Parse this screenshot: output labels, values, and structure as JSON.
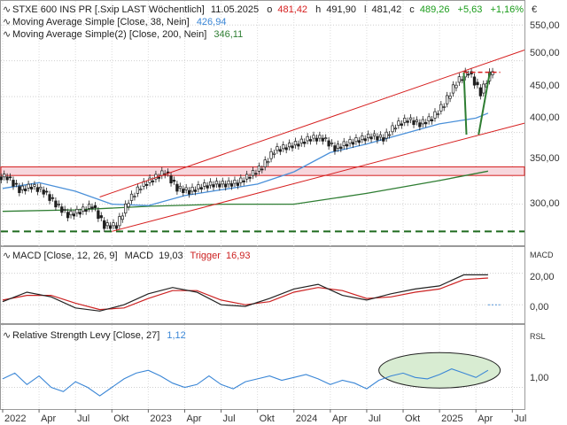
{
  "header": {
    "main": {
      "title": "STXE 600 INS PR [.Sxip LAST Wöchentlich]",
      "date": "11.05.2025",
      "o_label": "o",
      "o": "481,42",
      "h_label": "h",
      "h": "491,90",
      "l_label": "l",
      "l": "481,42",
      "c_label": "c",
      "c": "489,26",
      "change": "+5,63",
      "change_pct": "+1,16%"
    },
    "ma1": {
      "label": "Moving Average Simple [Close, 38, Nein]",
      "value": "426,94"
    },
    "ma2": {
      "label": "Moving Average Simple(2) [Close, 200, Nein]",
      "value": "346,11"
    },
    "macd": {
      "label": "MACD [Close, 12, 26, 9]",
      "macd_label": "MACD",
      "macd": "19,03",
      "trigger_label": "Trigger",
      "trigger": "16,93"
    },
    "rsl": {
      "label": "Relative Strength Levy [Close, 27]",
      "value": "1,12"
    }
  },
  "axis": {
    "currency": "€",
    "price_ticks": [
      "550,00",
      "500,00",
      "450,00",
      "400,00",
      "350,00",
      "300,00"
    ],
    "macd_name": "MACD",
    "macd_ticks": [
      "20,00",
      "0,00"
    ],
    "rsl_name": "RSL",
    "rsl_ticks": [
      "1,00"
    ],
    "x_ticks": [
      "2022",
      "Apr",
      "Jul",
      "Okt",
      "2023",
      "Apr",
      "Jul",
      "Okt",
      "2024",
      "Apr",
      "Jul",
      "Okt",
      "2025",
      "Apr",
      "Jul"
    ]
  },
  "colors": {
    "price": "#1f1f1f",
    "ma38": "#4a90d9",
    "ma200": "#2e7d32",
    "trend_channel": "#d62020",
    "resistance_band": "#d62020",
    "support_dashed": "#1e6b1e",
    "macd": "#222222",
    "trigger": "#cc2222",
    "rsl": "#3a86d6",
    "highlight_ellipse": "#c8e6c0",
    "up": "#1a9c1a",
    "down": "#d62020"
  },
  "chart_data": [
    {
      "type": "candlestick",
      "x_range": [
        "2022-01",
        "2025-08"
      ],
      "ylim": [
        255,
        570
      ],
      "grid": true,
      "series": [
        {
          "name": "STXE 600 INS PR [.Sxip LAST Wöchentlich]",
          "x": [
            "2022-01",
            "2022-02",
            "2022-03",
            "2022-04",
            "2022-05",
            "2022-06",
            "2022-07",
            "2022-08",
            "2022-09",
            "2022-10",
            "2022-11",
            "2022-12",
            "2023-01",
            "2023-02",
            "2023-03",
            "2023-04",
            "2023-05",
            "2023-06",
            "2023-07",
            "2023-08",
            "2023-09",
            "2023-10",
            "2023-11",
            "2023-12",
            "2024-01",
            "2024-02",
            "2024-03",
            "2024-04",
            "2024-05",
            "2024-06",
            "2024-07",
            "2024-08",
            "2024-09",
            "2024-10",
            "2024-11",
            "2024-12",
            "2025-01",
            "2025-02",
            "2025-03",
            "2025-04",
            "2025-05"
          ],
          "values": [
            338,
            320,
            325,
            318,
            300,
            285,
            290,
            298,
            270,
            270,
            305,
            325,
            335,
            345,
            322,
            318,
            325,
            328,
            328,
            330,
            340,
            352,
            375,
            380,
            385,
            392,
            392,
            378,
            385,
            390,
            395,
            392,
            410,
            418,
            412,
            420,
            440,
            470,
            485,
            455,
            489
          ]
        },
        {
          "name": "Moving Average Simple [Close, 38, Nein]",
          "x": [
            "2022-01",
            "2022-04",
            "2022-07",
            "2022-10",
            "2023-01",
            "2023-04",
            "2023-07",
            "2023-10",
            "2024-01",
            "2024-04",
            "2024-07",
            "2024-10",
            "2025-01",
            "2025-04",
            "2025-05"
          ],
          "values": [
            322,
            330,
            318,
            300,
            298,
            312,
            320,
            328,
            345,
            372,
            384,
            398,
            412,
            420,
            427
          ]
        },
        {
          "name": "Moving Average Simple(2) [Close, 200, Nein]",
          "x": [
            "2022-01",
            "2022-07",
            "2023-01",
            "2023-07",
            "2024-01",
            "2024-07",
            "2025-01",
            "2025-05"
          ],
          "values": [
            290,
            292,
            297,
            300,
            300,
            315,
            333,
            346
          ]
        }
      ],
      "trend_channel": {
        "upper": {
          "from": [
            "2022-09",
            310
          ],
          "to": [
            "2025-08",
            515
          ]
        },
        "lower": {
          "from": [
            "2022-10",
            262
          ],
          "to": [
            "2025-08",
            413
          ]
        }
      },
      "resistance_band": [
        340,
        352
      ],
      "support_level": 262,
      "annotations": {
        "forecast_v_top": 484,
        "forecast_v_bottom": 397,
        "forecast_v_end": 397
      }
    },
    {
      "type": "line",
      "ylim": [
        -10,
        35
      ],
      "series": [
        {
          "name": "MACD",
          "x": [
            "2022-01",
            "2022-03",
            "2022-05",
            "2022-07",
            "2022-09",
            "2022-11",
            "2023-01",
            "2023-03",
            "2023-05",
            "2023-07",
            "2023-09",
            "2023-11",
            "2024-01",
            "2024-03",
            "2024-05",
            "2024-07",
            "2024-09",
            "2024-11",
            "2025-01",
            "2025-03",
            "2025-05"
          ],
          "values": [
            2,
            8,
            5,
            -2,
            -4,
            0,
            7,
            11,
            8,
            0,
            -1,
            4,
            10,
            13,
            6,
            3,
            7,
            10,
            12,
            19,
            19
          ]
        },
        {
          "name": "Trigger",
          "x": [
            "2022-01",
            "2022-03",
            "2022-05",
            "2022-07",
            "2022-09",
            "2022-11",
            "2023-01",
            "2023-03",
            "2023-05",
            "2023-07",
            "2023-09",
            "2023-11",
            "2024-01",
            "2024-03",
            "2024-05",
            "2024-07",
            "2024-09",
            "2024-11",
            "2025-01",
            "2025-03",
            "2025-05"
          ],
          "values": [
            3,
            6,
            6,
            1,
            -3,
            -2,
            4,
            9,
            9,
            3,
            0,
            2,
            8,
            11,
            9,
            4,
            5,
            8,
            10,
            16,
            17
          ]
        }
      ]
    },
    {
      "type": "line",
      "ylim": [
        0.86,
        1.42
      ],
      "series": [
        {
          "name": "Relative Strength Levy [Close, 27]",
          "x": [
            "2022-01",
            "2022-02",
            "2022-03",
            "2022-04",
            "2022-05",
            "2022-06",
            "2022-07",
            "2022-08",
            "2022-09",
            "2022-10",
            "2022-11",
            "2022-12",
            "2023-01",
            "2023-02",
            "2023-03",
            "2023-04",
            "2023-05",
            "2023-06",
            "2023-07",
            "2023-08",
            "2023-09",
            "2023-10",
            "2023-11",
            "2023-12",
            "2024-01",
            "2024-02",
            "2024-03",
            "2024-04",
            "2024-05",
            "2024-06",
            "2024-07",
            "2024-08",
            "2024-09",
            "2024-10",
            "2024-11",
            "2024-12",
            "2025-01",
            "2025-02",
            "2025-03",
            "2025-04",
            "2025-05"
          ],
          "values": [
            1.06,
            1.1,
            1.02,
            1.08,
            1.0,
            0.97,
            1.04,
            1.0,
            0.94,
            1.0,
            1.06,
            1.1,
            1.12,
            1.08,
            1.03,
            1.0,
            1.02,
            1.08,
            1.02,
            0.99,
            1.04,
            1.06,
            1.08,
            1.05,
            1.07,
            1.09,
            1.06,
            1.02,
            1.05,
            1.03,
            0.99,
            1.05,
            1.08,
            1.1,
            1.07,
            1.06,
            1.09,
            1.13,
            1.1,
            1.07,
            1.12
          ]
        }
      ],
      "highlight": {
        "from": "2024-08",
        "to": "2025-06"
      }
    }
  ]
}
